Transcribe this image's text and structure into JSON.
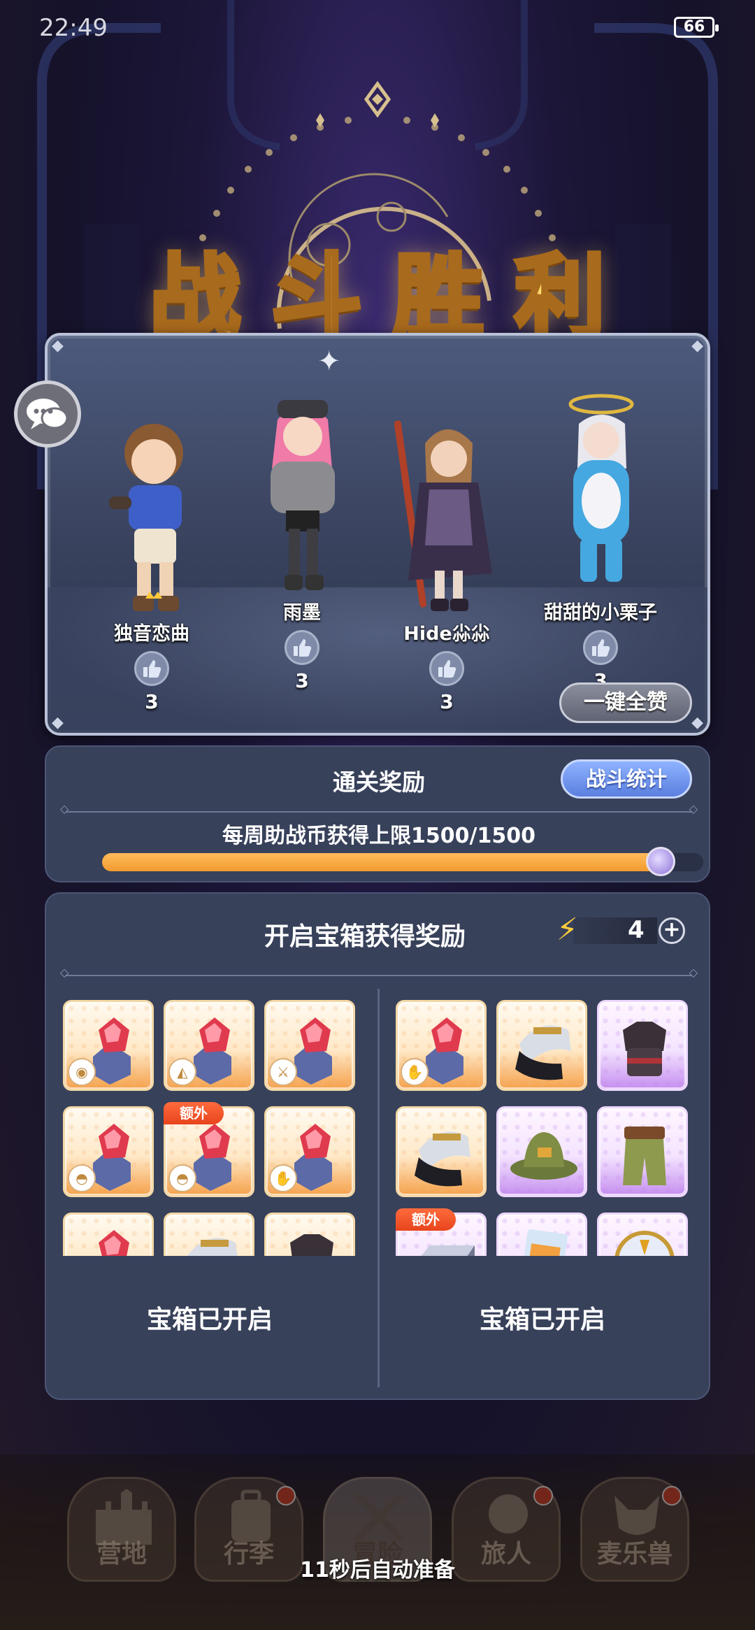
{
  "status": {
    "time": "22:49",
    "battery": "66"
  },
  "title": "战斗胜利",
  "players": [
    {
      "name": "独音恋曲",
      "likes": "3",
      "crown": true
    },
    {
      "name": "雨墨",
      "likes": "3"
    },
    {
      "name": "Hide尛尛",
      "likes": "3"
    },
    {
      "name": "甜甜的小栗子",
      "likes": "3"
    }
  ],
  "like_all_label": "一键全赞",
  "rewards": {
    "title": "通关奖励",
    "stats_label": "战斗统计",
    "weekly_text": "每周助战币获得上限1500/1500",
    "progress": 1.0
  },
  "chest": {
    "title": "开启宝箱获得奖励",
    "energy": "4",
    "extra_label": "额外",
    "left_opened": "宝箱已开启",
    "right_opened": "宝箱已开启"
  },
  "nav": {
    "items": [
      "营地",
      "行李",
      "冒险",
      "旅人",
      "麦乐兽"
    ],
    "auto_ready": "11秒后自动准备"
  },
  "colors": {
    "title_gold": "#ffd86a",
    "progress": "#f29a30",
    "stats_button": "#5a7fe0"
  }
}
